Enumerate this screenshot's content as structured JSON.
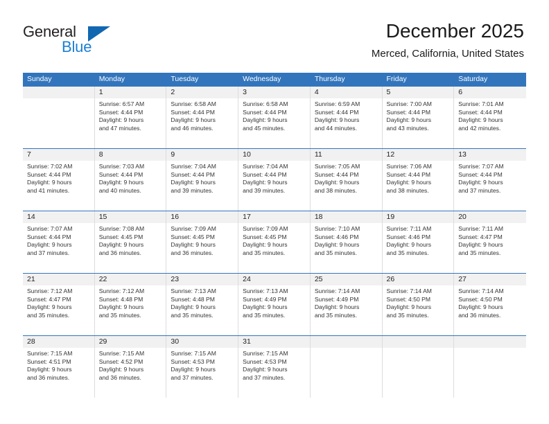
{
  "brand": {
    "name_part1": "General",
    "name_part2": "Blue",
    "triangle_color": "#1267b1",
    "blue_color": "#1c7fd4"
  },
  "header": {
    "title": "December 2025",
    "subtitle": "Merced, California, United States"
  },
  "theme": {
    "header_blue": "#3275bc",
    "day_band_gray": "#f1f1f1",
    "cell_divider": "#dcdcdc"
  },
  "labels": {
    "sunrise_prefix": "Sunrise:",
    "sunset_prefix": "Sunset:",
    "daylight_prefix": "Daylight:"
  },
  "weekday_headers": [
    "Sunday",
    "Monday",
    "Tuesday",
    "Wednesday",
    "Thursday",
    "Friday",
    "Saturday"
  ],
  "weeks": [
    [
      {
        "day": "",
        "l1": "",
        "l2": "",
        "l3": "",
        "l4": ""
      },
      {
        "day": "1",
        "l1": "Sunrise: 6:57 AM",
        "l2": "Sunset: 4:44 PM",
        "l3": "Daylight: 9 hours",
        "l4": "and 47 minutes."
      },
      {
        "day": "2",
        "l1": "Sunrise: 6:58 AM",
        "l2": "Sunset: 4:44 PM",
        "l3": "Daylight: 9 hours",
        "l4": "and 46 minutes."
      },
      {
        "day": "3",
        "l1": "Sunrise: 6:58 AM",
        "l2": "Sunset: 4:44 PM",
        "l3": "Daylight: 9 hours",
        "l4": "and 45 minutes."
      },
      {
        "day": "4",
        "l1": "Sunrise: 6:59 AM",
        "l2": "Sunset: 4:44 PM",
        "l3": "Daylight: 9 hours",
        "l4": "and 44 minutes."
      },
      {
        "day": "5",
        "l1": "Sunrise: 7:00 AM",
        "l2": "Sunset: 4:44 PM",
        "l3": "Daylight: 9 hours",
        "l4": "and 43 minutes."
      },
      {
        "day": "6",
        "l1": "Sunrise: 7:01 AM",
        "l2": "Sunset: 4:44 PM",
        "l3": "Daylight: 9 hours",
        "l4": "and 42 minutes."
      }
    ],
    [
      {
        "day": "7",
        "l1": "Sunrise: 7:02 AM",
        "l2": "Sunset: 4:44 PM",
        "l3": "Daylight: 9 hours",
        "l4": "and 41 minutes."
      },
      {
        "day": "8",
        "l1": "Sunrise: 7:03 AM",
        "l2": "Sunset: 4:44 PM",
        "l3": "Daylight: 9 hours",
        "l4": "and 40 minutes."
      },
      {
        "day": "9",
        "l1": "Sunrise: 7:04 AM",
        "l2": "Sunset: 4:44 PM",
        "l3": "Daylight: 9 hours",
        "l4": "and 39 minutes."
      },
      {
        "day": "10",
        "l1": "Sunrise: 7:04 AM",
        "l2": "Sunset: 4:44 PM",
        "l3": "Daylight: 9 hours",
        "l4": "and 39 minutes."
      },
      {
        "day": "11",
        "l1": "Sunrise: 7:05 AM",
        "l2": "Sunset: 4:44 PM",
        "l3": "Daylight: 9 hours",
        "l4": "and 38 minutes."
      },
      {
        "day": "12",
        "l1": "Sunrise: 7:06 AM",
        "l2": "Sunset: 4:44 PM",
        "l3": "Daylight: 9 hours",
        "l4": "and 38 minutes."
      },
      {
        "day": "13",
        "l1": "Sunrise: 7:07 AM",
        "l2": "Sunset: 4:44 PM",
        "l3": "Daylight: 9 hours",
        "l4": "and 37 minutes."
      }
    ],
    [
      {
        "day": "14",
        "l1": "Sunrise: 7:07 AM",
        "l2": "Sunset: 4:44 PM",
        "l3": "Daylight: 9 hours",
        "l4": "and 37 minutes."
      },
      {
        "day": "15",
        "l1": "Sunrise: 7:08 AM",
        "l2": "Sunset: 4:45 PM",
        "l3": "Daylight: 9 hours",
        "l4": "and 36 minutes."
      },
      {
        "day": "16",
        "l1": "Sunrise: 7:09 AM",
        "l2": "Sunset: 4:45 PM",
        "l3": "Daylight: 9 hours",
        "l4": "and 36 minutes."
      },
      {
        "day": "17",
        "l1": "Sunrise: 7:09 AM",
        "l2": "Sunset: 4:45 PM",
        "l3": "Daylight: 9 hours",
        "l4": "and 35 minutes."
      },
      {
        "day": "18",
        "l1": "Sunrise: 7:10 AM",
        "l2": "Sunset: 4:46 PM",
        "l3": "Daylight: 9 hours",
        "l4": "and 35 minutes."
      },
      {
        "day": "19",
        "l1": "Sunrise: 7:11 AM",
        "l2": "Sunset: 4:46 PM",
        "l3": "Daylight: 9 hours",
        "l4": "and 35 minutes."
      },
      {
        "day": "20",
        "l1": "Sunrise: 7:11 AM",
        "l2": "Sunset: 4:47 PM",
        "l3": "Daylight: 9 hours",
        "l4": "and 35 minutes."
      }
    ],
    [
      {
        "day": "21",
        "l1": "Sunrise: 7:12 AM",
        "l2": "Sunset: 4:47 PM",
        "l3": "Daylight: 9 hours",
        "l4": "and 35 minutes."
      },
      {
        "day": "22",
        "l1": "Sunrise: 7:12 AM",
        "l2": "Sunset: 4:48 PM",
        "l3": "Daylight: 9 hours",
        "l4": "and 35 minutes."
      },
      {
        "day": "23",
        "l1": "Sunrise: 7:13 AM",
        "l2": "Sunset: 4:48 PM",
        "l3": "Daylight: 9 hours",
        "l4": "and 35 minutes."
      },
      {
        "day": "24",
        "l1": "Sunrise: 7:13 AM",
        "l2": "Sunset: 4:49 PM",
        "l3": "Daylight: 9 hours",
        "l4": "and 35 minutes."
      },
      {
        "day": "25",
        "l1": "Sunrise: 7:14 AM",
        "l2": "Sunset: 4:49 PM",
        "l3": "Daylight: 9 hours",
        "l4": "and 35 minutes."
      },
      {
        "day": "26",
        "l1": "Sunrise: 7:14 AM",
        "l2": "Sunset: 4:50 PM",
        "l3": "Daylight: 9 hours",
        "l4": "and 35 minutes."
      },
      {
        "day": "27",
        "l1": "Sunrise: 7:14 AM",
        "l2": "Sunset: 4:50 PM",
        "l3": "Daylight: 9 hours",
        "l4": "and 36 minutes."
      }
    ],
    [
      {
        "day": "28",
        "l1": "Sunrise: 7:15 AM",
        "l2": "Sunset: 4:51 PM",
        "l3": "Daylight: 9 hours",
        "l4": "and 36 minutes."
      },
      {
        "day": "29",
        "l1": "Sunrise: 7:15 AM",
        "l2": "Sunset: 4:52 PM",
        "l3": "Daylight: 9 hours",
        "l4": "and 36 minutes."
      },
      {
        "day": "30",
        "l1": "Sunrise: 7:15 AM",
        "l2": "Sunset: 4:53 PM",
        "l3": "Daylight: 9 hours",
        "l4": "and 37 minutes."
      },
      {
        "day": "31",
        "l1": "Sunrise: 7:15 AM",
        "l2": "Sunset: 4:53 PM",
        "l3": "Daylight: 9 hours",
        "l4": "and 37 minutes."
      },
      {
        "day": "",
        "l1": "",
        "l2": "",
        "l3": "",
        "l4": ""
      },
      {
        "day": "",
        "l1": "",
        "l2": "",
        "l3": "",
        "l4": ""
      },
      {
        "day": "",
        "l1": "",
        "l2": "",
        "l3": "",
        "l4": ""
      }
    ]
  ]
}
